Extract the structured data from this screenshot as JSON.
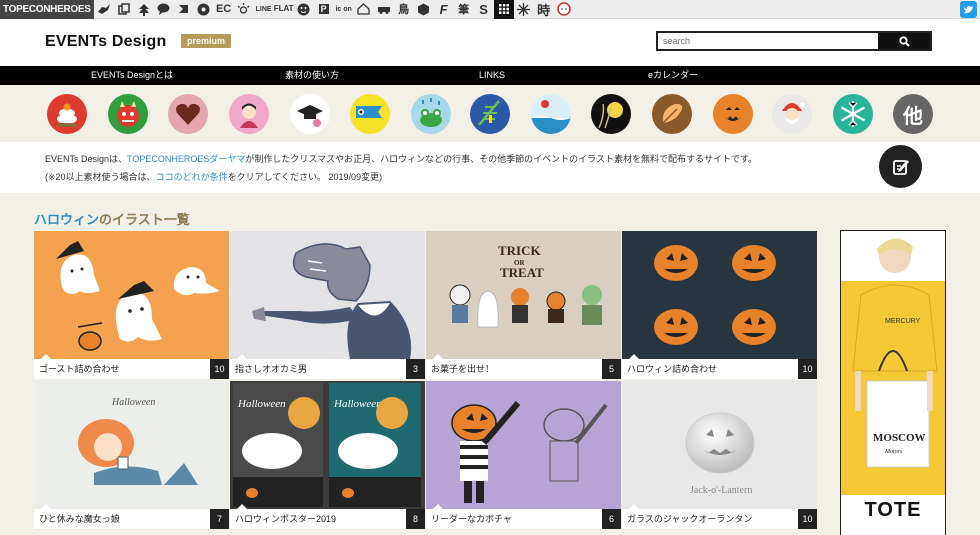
{
  "topbar": {
    "brand": "TOPECONHEROES",
    "icons": [
      "bird-icon",
      "copy-icon",
      "tree-icon",
      "chat-icon",
      "fish-icon",
      "flower-icon",
      "EC",
      "sun-icon",
      "LINE",
      "FLAT",
      "face-icon",
      "P",
      "icon",
      "house-icon",
      "car-icon",
      "鳥",
      "hexagon-icon",
      "F",
      "筆",
      "S",
      "grid-icon",
      "burst-icon",
      "時",
      "girl-icon"
    ],
    "icon_texts": {
      "ec": "EC",
      "line": "LINE",
      "flat": "FLAT",
      "p": "P",
      "icon": "ic on",
      "bird": "鳥",
      "f": "F",
      "fude": "筆",
      "s": "S",
      "toki": "時"
    }
  },
  "header": {
    "logo": "EVENTs Design",
    "premium": "premium",
    "search_placeholder": "search"
  },
  "nav": {
    "items": [
      "EVENTs Designとは",
      "素材の使い方",
      "LINKS",
      "eカレンダー"
    ]
  },
  "categories": [
    {
      "name": "kagami-mochi",
      "color": "#e03a2f"
    },
    {
      "name": "oni",
      "color": "#2e9e3e"
    },
    {
      "name": "heart",
      "color": "#e6a6b0"
    },
    {
      "name": "hina",
      "color": "#f0a8c8"
    },
    {
      "name": "graduation",
      "color": "#ffffff"
    },
    {
      "name": "koinobori",
      "color": "#f5e32a"
    },
    {
      "name": "frog-rain",
      "color": "#a6d8e8"
    },
    {
      "name": "tanabata",
      "color": "#2b59a8"
    },
    {
      "name": "summer",
      "color": "#d9eef5"
    },
    {
      "name": "tsukimi",
      "color": "#111111"
    },
    {
      "name": "autumn",
      "color": "#8a5a2a"
    },
    {
      "name": "halloween",
      "color": "#e8822a"
    },
    {
      "name": "christmas",
      "color": "#e8e8e8"
    },
    {
      "name": "winter",
      "color": "#2ab59a"
    },
    {
      "name": "other",
      "color": "#666666"
    }
  ],
  "categories_other_label": "他",
  "intro": {
    "l1_pre": "EVENTs Designは、",
    "l1_link": "TOPECONHEROESダーヤマ",
    "l1_post": "が制作したクリスマスやお正月、ハロウィンなどの行事、その他季節のイベントのイラスト素材を無料で配布するサイトです。",
    "l2_pre": "(※20以上素材使う場合は、",
    "l2_link": "ココのどれか条件",
    "l2_post": "をクリアしてください。 2019/09変更)"
  },
  "section": {
    "highlight": "ハロウィン",
    "rest": "のイラスト一覧"
  },
  "cards": [
    {
      "title": "ゴースト詰め合わせ",
      "count": "10",
      "bg": "#f4a24d"
    },
    {
      "title": "指さしオオカミ男",
      "count": "3",
      "bg": "#e3e3e5"
    },
    {
      "title": "お菓子を出せ！",
      "count": "5",
      "bg": "#d8cfc0"
    },
    {
      "title": "ハロウィン詰め合わせ",
      "count": "10",
      "bg": "#26353f"
    },
    {
      "title": "ひと休みな魔女っ娘",
      "count": "7",
      "bg": "#eceeea"
    },
    {
      "title": "ハロウィンポスター2019",
      "count": "8",
      "bg": "#3c3c3c"
    },
    {
      "title": "リーダーなカボチャ",
      "count": "6",
      "bg": "#b7a4d6"
    },
    {
      "title": "ガラスのジャックオーランタン",
      "count": "10",
      "bg": "#e8e8e8"
    }
  ],
  "card_texts": {
    "trick": "TRICK",
    "or": "OR",
    "treat": "TREAT",
    "halloween": "Halloween",
    "jack": "Jack-o'-Lantern"
  },
  "ad": {
    "shirt_text": "MERCURY",
    "bag_text": "MOSCOW",
    "bag_sub": "Motors",
    "tote": "TOTE"
  },
  "colors": {
    "accent": "#2a8fc7",
    "bg": "#f2efe6",
    "premium": "#b59a5a"
  }
}
